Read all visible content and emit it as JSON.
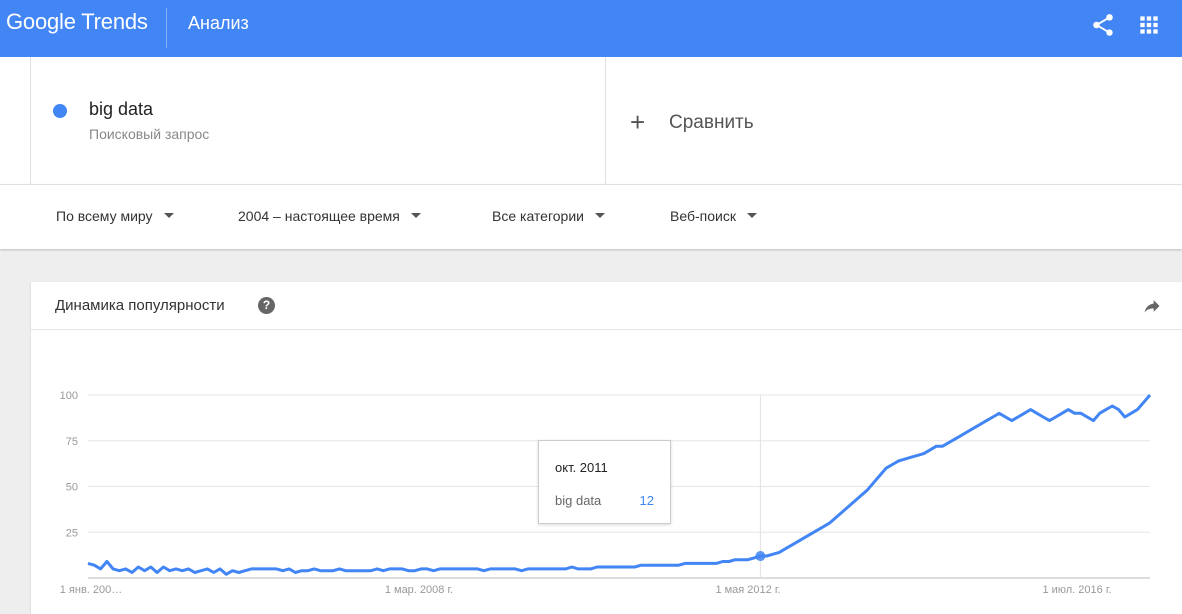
{
  "header": {
    "logo_text": "Google Trends",
    "page_title": "Анализ",
    "share_icon": "share-icon",
    "apps_icon": "apps-grid-icon",
    "bg_color": "#4285f4"
  },
  "search": {
    "term": "big data",
    "term_type": "Поисковый запрос",
    "term_color": "#4285f4",
    "compare_label": "Сравнить",
    "compare_icon": "plus-icon"
  },
  "filters": [
    {
      "label": "По всему миру"
    },
    {
      "label": "2004 – настоящее время"
    },
    {
      "label": "Все категории"
    },
    {
      "label": "Веб-поиск"
    }
  ],
  "card": {
    "title": "Динамика популярности",
    "help_icon": "question-mark-icon",
    "help_glyph": "?",
    "share_icon": "share-arrow-icon"
  },
  "tooltip": {
    "date": "окт. 2011",
    "term": "big data",
    "value": "12"
  },
  "chart_data": {
    "type": "line",
    "title": "Динамика популярности",
    "ylim": [
      0,
      100
    ],
    "y_ticks": [
      25,
      50,
      75,
      100
    ],
    "y_tick_labels": [
      "25",
      "50",
      "75",
      "100"
    ],
    "x_tick_labels": [
      "1 янв. 200…",
      "1 мар. 2008 г.",
      "1 мая 2012 г.",
      "1 июл. 2016 г."
    ],
    "grid": true,
    "series": [
      {
        "name": "big data",
        "color": "#4285f4",
        "values": [
          8,
          7,
          5,
          9,
          5,
          4,
          5,
          3,
          6,
          4,
          6,
          3,
          6,
          4,
          5,
          4,
          5,
          3,
          4,
          5,
          3,
          5,
          2,
          4,
          3,
          4,
          5,
          5,
          5,
          5,
          5,
          4,
          5,
          3,
          4,
          4,
          5,
          4,
          4,
          4,
          5,
          4,
          4,
          4,
          4,
          4,
          5,
          4,
          5,
          5,
          5,
          4,
          4,
          5,
          5,
          4,
          5,
          5,
          5,
          5,
          5,
          5,
          5,
          4,
          5,
          5,
          5,
          5,
          5,
          4,
          5,
          5,
          5,
          5,
          5,
          5,
          5,
          6,
          5,
          5,
          5,
          6,
          6,
          6,
          6,
          6,
          6,
          6,
          7,
          7,
          7,
          7,
          7,
          7,
          7,
          8,
          8,
          8,
          8,
          8,
          8,
          9,
          9,
          10,
          10,
          10,
          11,
          12,
          12,
          13,
          14,
          16,
          18,
          20,
          22,
          24,
          26,
          28,
          30,
          33,
          36,
          39,
          42,
          45,
          48,
          52,
          56,
          60,
          62,
          64,
          65,
          66,
          67,
          68,
          70,
          72,
          72,
          74,
          76,
          78,
          80,
          82,
          84,
          86,
          88,
          90,
          88,
          86,
          88,
          90,
          92,
          90,
          88,
          86,
          88,
          90,
          92,
          90,
          90,
          88,
          86,
          90,
          92,
          94,
          92,
          88,
          90,
          92,
          96,
          100
        ]
      }
    ]
  }
}
